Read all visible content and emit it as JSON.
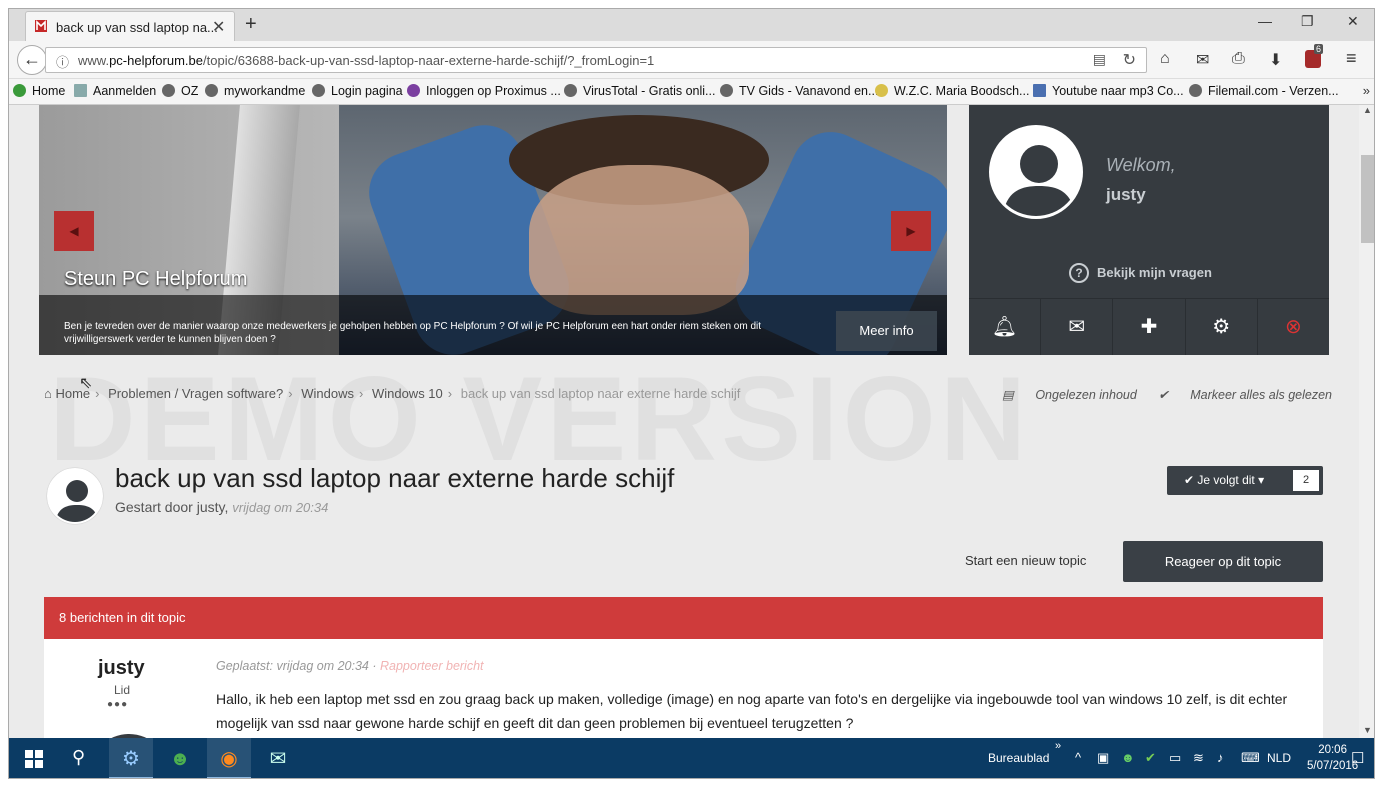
{
  "browser": {
    "tab_title": "back up van ssd laptop na...",
    "tab_close": "✕",
    "new_tab": "+",
    "url_domain": "pc-helpforum.be",
    "url_prefix": "www.",
    "url_path": "/topic/63688-back-up-van-ssd-laptop-naar-externe-harde-schijf/?_fromLogin=1",
    "ublock_count": "6"
  },
  "bookmarks": [
    {
      "label": "Home"
    },
    {
      "label": "Aanmelden"
    },
    {
      "label": "OZ"
    },
    {
      "label": "myworkandme"
    },
    {
      "label": "Login pagina"
    },
    {
      "label": "Inloggen op Proximus ..."
    },
    {
      "label": "VirusTotal - Gratis onli..."
    },
    {
      "label": "TV Gids - Vanavond en..."
    },
    {
      "label": "W.Z.C. Maria Boodsch..."
    },
    {
      "label": "Youtube naar mp3 Co..."
    },
    {
      "label": "Filemail.com - Verzen..."
    }
  ],
  "hero": {
    "caption": "Steun PC Helpforum",
    "description": "Ben je tevreden over de manier waarop onze medewerkers je geholpen hebben op PC Helpforum ? Of wil je PC Helpforum een hart onder riem steken om dit vrijwilligerswerk verder te kunnen blijven doen ?",
    "more_button": "Meer info"
  },
  "user_panel": {
    "welcome": "Welkom,",
    "username": "justy",
    "my_questions": "Bekijk mijn vragen"
  },
  "watermark": "DEMO VERSION",
  "breadcrumb": {
    "items": [
      "Home",
      "Problemen / Vragen software?",
      "Windows",
      "Windows 10"
    ],
    "current": "back up van ssd laptop naar externe harde schijf",
    "unread": "Ongelezen inhoud",
    "mark_read": "Markeer alles als gelezen"
  },
  "topic": {
    "title": "back up van ssd laptop naar externe harde schijf",
    "started_by": "Gestart door justy,",
    "started_when": "vrijdag om 20:34",
    "follow_label": "Je volgt dit",
    "follow_count": "2",
    "new_topic": "Start een nieuw topic",
    "reply": "Reageer op dit topic",
    "posts_count_label": "8 berichten in dit topic"
  },
  "post": {
    "author": "justy",
    "role": "Lid",
    "dots": "●●●",
    "posted": "Geplaatst: vrijdag om 20:34",
    "separator": " · ",
    "report": "Rapporteer bericht",
    "body": "Hallo, ik heb een laptop met ssd en zou graag back up maken, volledige (image) en nog aparte van foto's en dergelijke via ingebouwde tool van windows 10 zelf, is dit echter mogelijk van ssd naar gewone harde schijf en geeft dit dan geen problemen bij eventueel terugzetten ?"
  },
  "taskbar": {
    "desktop_label": "Bureaublad",
    "language": "NLD",
    "time": "20:06",
    "date": "5/07/2016"
  },
  "colors": {
    "accent_red": "#cf3b3b",
    "dark_panel": "#363b40",
    "taskbar": "#0b3b64"
  }
}
